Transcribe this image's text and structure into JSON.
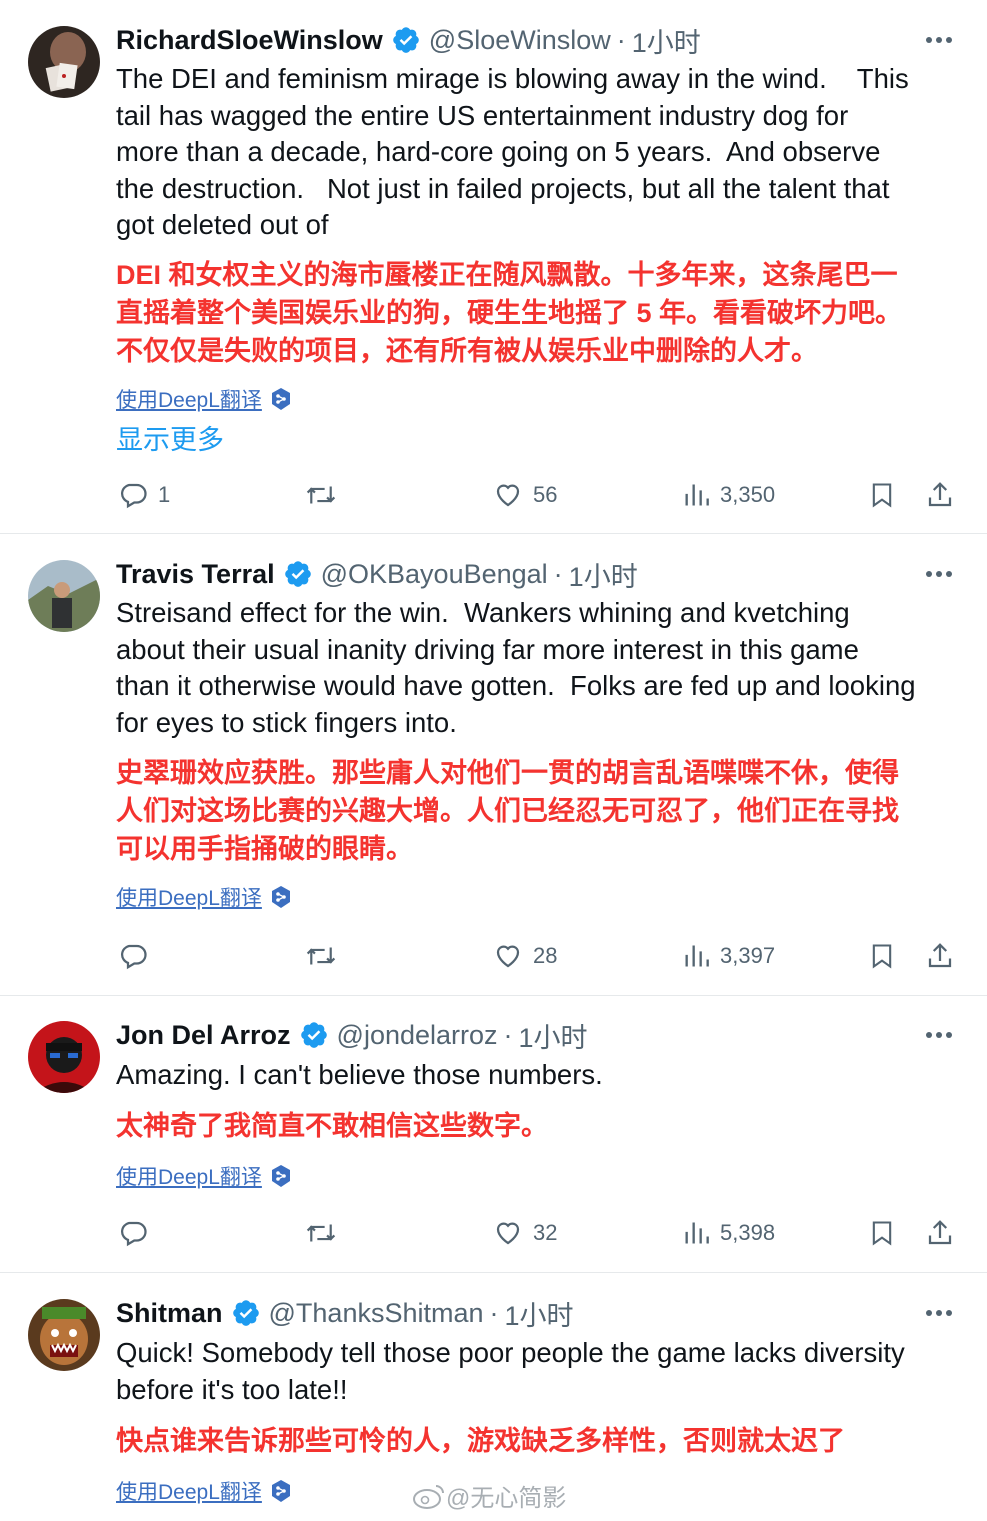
{
  "tweets": [
    {
      "name": "RichardSloeWinslow",
      "handle": "@SloeWinslow",
      "time": "1小时",
      "text": "The DEI and feminism mirage is blowing away in the wind.    This\ntail has wagged the entire US entertainment industry dog for\nmore than a decade, hard-core going on 5 years.  And observe\nthe destruction.   Not just in failed projects, but all the talent that\ngot deleted out of",
      "translation": "DEI 和女权主义的海市蜃楼正在随风飘散。十多年来，这条尾巴一\n直摇着整个美国娱乐业的狗，硬生生地摇了 5 年。看看破坏力吧。\n不仅仅是失败的项目，还有所有被从娱乐业中删除的人才。",
      "deepl": "使用DeepL翻译",
      "show_more": "显示更多",
      "replies": "1",
      "retweets": "",
      "likes": "56",
      "views": "3,350",
      "avatar_color": "#4a3b34"
    },
    {
      "name": "Travis Terral",
      "handle": "@OKBayouBengal",
      "time": "1小时",
      "text": "Streisand effect for the win.  Wankers whining and kvetching\nabout their usual inanity driving far more interest in this game\nthan it otherwise would have gotten.  Folks are fed up and looking\nfor eyes to stick fingers into.",
      "translation": "史翠珊效应获胜。那些庸人对他们一贯的胡言乱语喋喋不休，使得\n人们对这场比赛的兴趣大增。人们已经忍无可忍了，他们正在寻找\n可以用手指捅破的眼睛。",
      "deepl": "使用DeepL翻译",
      "replies": "",
      "retweets": "",
      "likes": "28",
      "views": "3,397",
      "avatar_color": "#7d8a6a"
    },
    {
      "name": "Jon Del Arroz",
      "handle": "@jondelarroz",
      "time": "1小时",
      "text": "Amazing. I can't believe those numbers.",
      "translation": "太神奇了我简直不敢相信这些数字。",
      "deepl": "使用DeepL翻译",
      "replies": "",
      "retweets": "",
      "likes": "32",
      "views": "5,398",
      "avatar_color": "#c4141a"
    },
    {
      "name": "Shitman",
      "handle": "@ThanksShitman",
      "time": "1小时",
      "text": "Quick! Somebody tell those poor people the game lacks diversity\nbefore it's too late!!",
      "translation": "快点谁来告诉那些可怜的人，游戏缺乏多样性，否则就太迟了",
      "deepl": "使用DeepL翻译",
      "avatar_color": "#8a6a3a"
    }
  ],
  "separator": "·",
  "watermark": "@无心简影",
  "colors": {
    "verified": "#1d9bf0",
    "translation": "#f4332f",
    "muted": "#536471",
    "link": "#3b6ec0"
  }
}
